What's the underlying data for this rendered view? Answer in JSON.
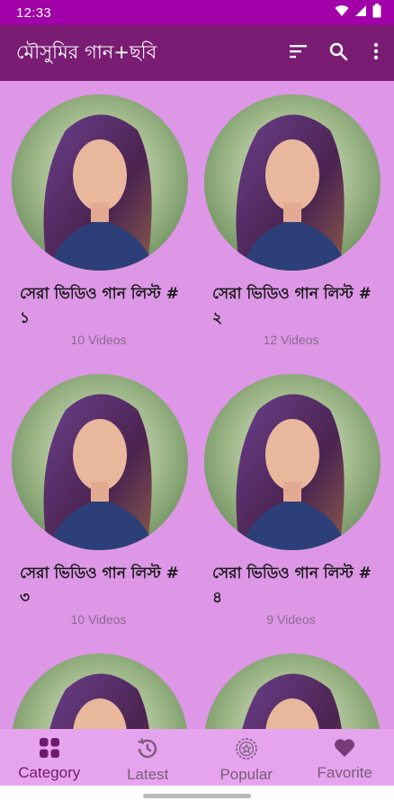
{
  "status_bar": {
    "time": "12:33"
  },
  "app_bar": {
    "title": "মৌসুমির গান+ছবি",
    "actions": [
      {
        "icon": "sort-icon"
      },
      {
        "icon": "search-icon"
      },
      {
        "icon": "more-vert-icon"
      }
    ]
  },
  "grid": {
    "items": [
      {
        "title": "সেরা ভিডিও গান লিস্ট # ১",
        "count": "10 Videos"
      },
      {
        "title": "সেরা ভিডিও গান লিস্ট # ২",
        "count": "12 Videos"
      },
      {
        "title": "সেরা ভিডিও গান লিস্ট # ৩",
        "count": "10 Videos"
      },
      {
        "title": "সেরা ভিডিও গান লিস্ট # ৪",
        "count": "9 Videos"
      },
      {
        "title": "",
        "count": ""
      },
      {
        "title": "",
        "count": ""
      }
    ]
  },
  "bottom_nav": {
    "items": [
      {
        "label": "Category",
        "icon": "category-grid-icon",
        "active": true
      },
      {
        "label": "Latest",
        "icon": "history-clock-icon",
        "active": false
      },
      {
        "label": "Popular",
        "icon": "star-badge-icon",
        "active": false
      },
      {
        "label": "Favorite",
        "icon": "heart-icon",
        "active": false
      }
    ]
  },
  "colors": {
    "status_bar": "#a100a8",
    "app_bar": "#7a1c74",
    "content_bg": "#dd97e6",
    "bottom_nav": "#e6a4ee",
    "active_nav": "#6f1a6f"
  }
}
